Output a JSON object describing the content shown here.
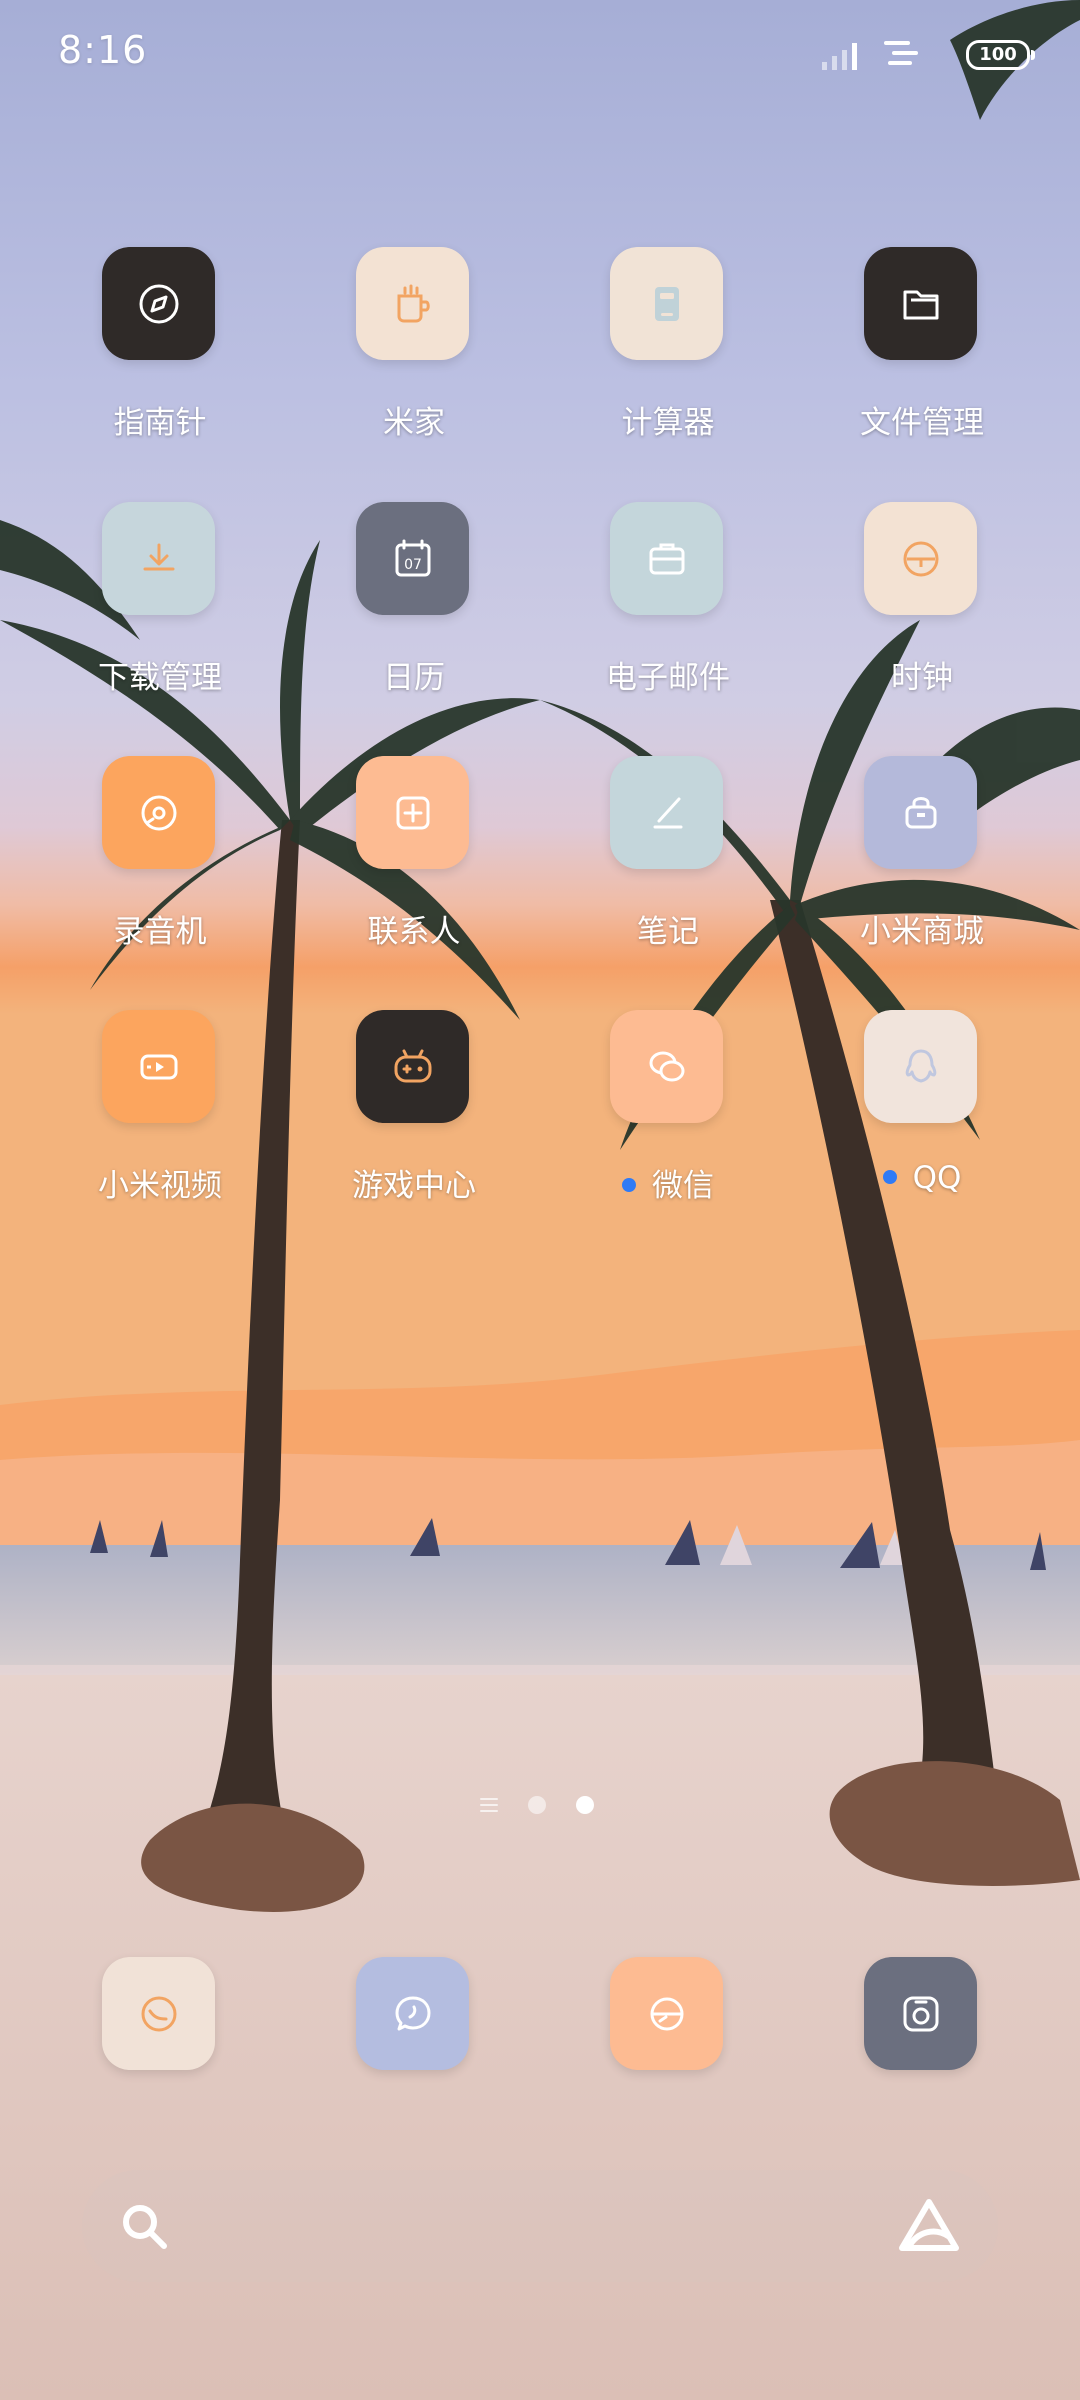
{
  "status_bar": {
    "time": "8:16",
    "battery": "100",
    "icons": [
      "signal-icon",
      "wifi-icon",
      "battery-icon"
    ]
  },
  "apps": [
    {
      "label": "指南针",
      "icon": "compass-icon",
      "tile_color": "#2f2a28"
    },
    {
      "label": "米家",
      "icon": "mijia-icon",
      "tile_color": "#f3e2d3"
    },
    {
      "label": "计算器",
      "icon": "calculator-icon",
      "tile_color": "#f1e3d6"
    },
    {
      "label": "文件管理",
      "icon": "folder-icon",
      "tile_color": "#2f2a28"
    },
    {
      "label": "下载管理",
      "icon": "download-icon",
      "tile_color": "#c6d6dc"
    },
    {
      "label": "日历",
      "icon": "calendar-icon",
      "tile_color": "#6b6f7f",
      "calendar_day": "07"
    },
    {
      "label": "电子邮件",
      "icon": "mail-icon",
      "tile_color": "#c4d6db"
    },
    {
      "label": "时钟",
      "icon": "clock-icon",
      "tile_color": "#f3e2d3"
    },
    {
      "label": "录音机",
      "icon": "recorder-icon",
      "tile_color": "#fca55e"
    },
    {
      "label": "联系人",
      "icon": "contacts-icon",
      "tile_color": "#fdbb92"
    },
    {
      "label": "笔记",
      "icon": "notes-icon",
      "tile_color": "#c4d6db"
    },
    {
      "label": "小米商城",
      "icon": "shop-icon",
      "tile_color": "#b4b9da"
    },
    {
      "label": "小米视频",
      "icon": "video-icon",
      "tile_color": "#fca55e"
    },
    {
      "label": "游戏中心",
      "icon": "game-icon",
      "tile_color": "#2f2a28"
    },
    {
      "label": "微信",
      "icon": "wechat-icon",
      "tile_color": "#fdbb92",
      "new_dot": true
    },
    {
      "label": "QQ",
      "icon": "qq-icon",
      "tile_color": "#f1e4dc",
      "new_dot": true
    }
  ],
  "page_indicator": {
    "pages": 2,
    "current": 2
  },
  "dock": [
    {
      "icon": "phone-icon",
      "tile_color": "#f1e2d7"
    },
    {
      "icon": "messages-icon",
      "tile_color": "#b4bde0"
    },
    {
      "icon": "browser-icon",
      "tile_color": "#fdbb92"
    },
    {
      "icon": "camera-icon",
      "tile_color": "#6b6f7f"
    }
  ],
  "search_bar": {
    "left_icon": "search-icon",
    "right_icon": "assistant-icon"
  }
}
